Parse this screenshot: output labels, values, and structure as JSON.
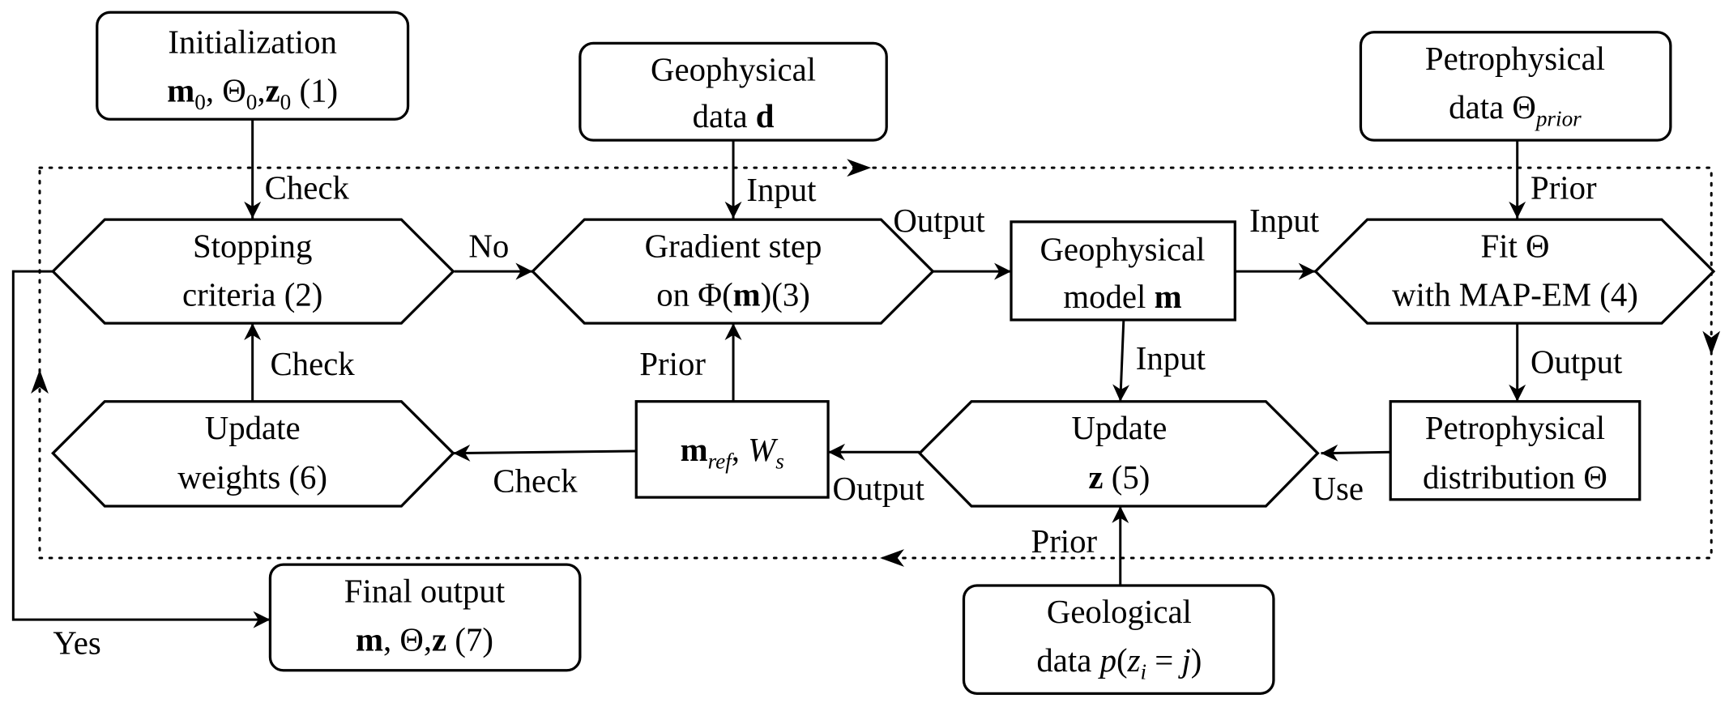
{
  "nodes": {
    "init": [
      [
        {
          "t": "Initialization"
        }
      ],
      [
        {
          "t": "m",
          "s": "b"
        },
        {
          "t": "0",
          "s": "sub"
        },
        {
          "t": ", Θ"
        },
        {
          "t": "0",
          "s": "sub"
        },
        {
          "t": ","
        },
        {
          "t": "z",
          "s": "b"
        },
        {
          "t": "0",
          "s": "sub"
        },
        {
          "t": " (1)"
        }
      ]
    ],
    "geo_data": [
      [
        {
          "t": "Geophysical"
        }
      ],
      [
        {
          "t": "data "
        },
        {
          "t": "d",
          "s": "b"
        }
      ]
    ],
    "petro_data": [
      [
        {
          "t": "Petrophysical"
        }
      ],
      [
        {
          "t": "data Θ"
        },
        {
          "t": "prior",
          "s": "isub"
        }
      ]
    ],
    "stopping": [
      [
        {
          "t": "Stopping"
        }
      ],
      [
        {
          "t": "criteria (2)"
        }
      ]
    ],
    "gradient": [
      [
        {
          "t": "Gradient step"
        }
      ],
      [
        {
          "t": "on Φ("
        },
        {
          "t": "m",
          "s": "b"
        },
        {
          "t": ")(3)"
        }
      ]
    ],
    "geo_model": [
      [
        {
          "t": "Geophysical"
        }
      ],
      [
        {
          "t": "model "
        },
        {
          "t": "m",
          "s": "b"
        }
      ]
    ],
    "fit": [
      [
        {
          "t": "Fit Θ"
        }
      ],
      [
        {
          "t": "with MAP-EM (4)"
        }
      ]
    ],
    "weights": [
      [
        {
          "t": "Update"
        }
      ],
      [
        {
          "t": "weights (6)"
        }
      ]
    ],
    "mref": [
      [
        {
          "t": "m",
          "s": "b"
        },
        {
          "t": "ref",
          "s": "isub"
        },
        {
          "t": ", "
        },
        {
          "t": "W",
          "s": "i"
        },
        {
          "t": "s",
          "s": "isub"
        }
      ]
    ],
    "update_z": [
      [
        {
          "t": "Update"
        }
      ],
      [
        {
          "t": "z",
          "s": "b"
        },
        {
          "t": " (5)"
        }
      ]
    ],
    "petro_dist": [
      [
        {
          "t": "Petrophysical"
        }
      ],
      [
        {
          "t": "distribution Θ"
        }
      ]
    ],
    "geological": [
      [
        {
          "t": "Geological"
        }
      ],
      [
        {
          "t": "data "
        },
        {
          "t": "p",
          "s": "i"
        },
        {
          "t": "("
        },
        {
          "t": "z",
          "s": "i"
        },
        {
          "t": "i",
          "s": "isub"
        },
        {
          "t": " = "
        },
        {
          "t": "j",
          "s": "i"
        },
        {
          "t": ")"
        }
      ]
    ],
    "final": [
      [
        {
          "t": "Final output"
        }
      ],
      [
        {
          "t": "m",
          "s": "b"
        },
        {
          "t": ", Θ,"
        },
        {
          "t": "z",
          "s": "b"
        },
        {
          "t": " (7)"
        }
      ]
    ]
  },
  "edge_labels": {
    "init_check": "Check",
    "geo_input": "Input",
    "no": "No",
    "grad_output": "Output",
    "model_input": "Input",
    "petro_prior": "Prior",
    "fit_output": "Output",
    "use": "Use",
    "model_input2": "Input",
    "geo_prior": "Prior",
    "z_output": "Output",
    "mref_check": "Check",
    "mref_prior": "Prior",
    "weights_check": "Check",
    "yes": "Yes"
  }
}
